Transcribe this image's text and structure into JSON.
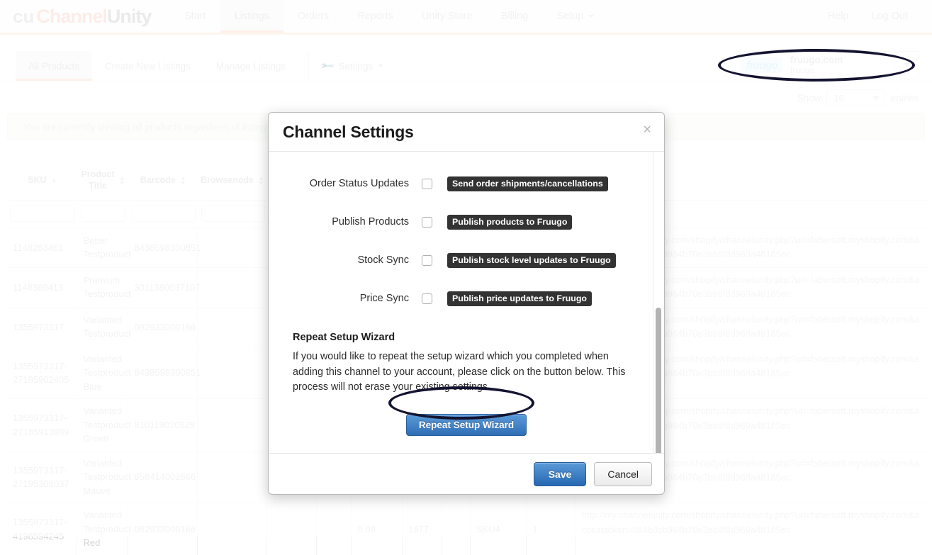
{
  "brand": {
    "mark": "cu",
    "name_1": "Channel",
    "name_2": "Unity"
  },
  "topnav": {
    "items": [
      {
        "label": "Start",
        "active": false
      },
      {
        "label": "Listings",
        "active": true
      },
      {
        "label": "Orders",
        "active": false
      },
      {
        "label": "Reports",
        "active": false
      },
      {
        "label": "Unity Store",
        "active": false
      },
      {
        "label": "Billing",
        "active": false
      },
      {
        "label": "Setup",
        "active": false,
        "caret": true
      }
    ],
    "right": [
      {
        "label": "Help"
      },
      {
        "label": "Log Out"
      }
    ]
  },
  "subtabs": [
    {
      "label": "All Products",
      "active": true
    },
    {
      "label": "Create New Listings",
      "active": false
    },
    {
      "label": "Manage Listings",
      "active": false
    },
    {
      "label": "Settings",
      "active": false,
      "icon": "wrench-icon",
      "caret": true
    }
  ],
  "channel_selector": {
    "logo_text": "fruugo",
    "name": "fruugo.com",
    "sub": "fruugo"
  },
  "show_entries": {
    "prefix": "Show",
    "value": "10",
    "suffix": "entries"
  },
  "alert": {
    "text": "You are currently viewing all products regardless of listing status."
  },
  "table": {
    "columns": [
      {
        "key": "sku",
        "label": "SKU",
        "sort": "asc"
      },
      {
        "key": "title",
        "label": "Product Title",
        "sort": "both"
      },
      {
        "key": "barcode",
        "label": "Barcode",
        "sort": "both"
      },
      {
        "key": "browsenode",
        "label": "Browsenode",
        "sort": "both"
      }
    ],
    "filter_placeholder": "",
    "rows": [
      {
        "sku": "1148283461",
        "title": "Better Testproduct",
        "barcode": "8438598300851",
        "url": "http://my.channelunity.com/shopify/channelunity.php?url=fabersoft.myshopify.com&accesstoken=084b8cb964b70e3bb9f8d969a48185ec"
      },
      {
        "sku": "1148369413",
        "title": "Premium Testproduct",
        "barcode": "3011360037107",
        "url": "http://my.channelunity.com/shopify/channelunity.php?url=fabersoft.myshopify.com&accesstoken=084b8cb964b70e3bb9f8d969a48185ec"
      },
      {
        "sku": "1355973317",
        "title": "Varianted Testproduct",
        "barcode": "082933000166",
        "url": "http://my.channelunity.com/shopify/channelunity.php?url=fabersoft.myshopify.com&accesstoken=084b8cb964b70e3bb9f8d969a48185ec"
      },
      {
        "sku": "1355973317-27185902405",
        "title": "Varianted Testproduct Blue",
        "barcode": "8438598300851",
        "url": "http://my.channelunity.com/shopify/channelunity.php?url=fabersoft.myshopify.com&accesstoken=084b8cb964b70e3bb9f8d969a48185ec"
      },
      {
        "sku": "1355973317-27185913989",
        "title": "Varianted Testproduct Green",
        "barcode": "810119020529",
        "url": "http://my.channelunity.com/shopify/channelunity.php?url=fabersoft.myshopify.com&accesstoken=084b8cb964b70e3bb9f8d969a48185ec"
      },
      {
        "sku": "1355973317-27195308037",
        "title": "Varianted Testproduct Mauve",
        "barcode": "858414002666",
        "url": "http://my.channelunity.com/shopify/channelunity.php?url=fabersoft.myshopify.com&accesstoken=084b8cb964b70e3bb9f8d969a48185ec"
      },
      {
        "sku": "1355973317-4198594245",
        "title": "Varianted Testproduct Red",
        "barcode": "082933000166",
        "price": "0.99",
        "qty": "1977",
        "code": "SKU4",
        "flag": "1",
        "url": "http://my.channelunity.com/shopify/channelunity.php?url=fabersoft.myshopify.com&accesstoken=084b8cb964b70e3bb9f8d969a48185ec"
      }
    ]
  },
  "modal": {
    "title": "Channel Settings",
    "close_label": "×",
    "rows": [
      {
        "label": "Order Status Updates",
        "tip": "Send order shipments/cancellations",
        "checked": false
      },
      {
        "label": "Publish Products",
        "tip": "Publish products to Fruugo",
        "checked": false
      },
      {
        "label": "Stock Sync",
        "tip": "Publish stock level updates to Fruugo",
        "checked": false
      },
      {
        "label": "Price Sync",
        "tip": "Publish price updates to Fruugo",
        "checked": false
      }
    ],
    "wizard": {
      "heading": "Repeat Setup Wizard",
      "body": "If you would like to repeat the setup wizard which you completed when adding this channel to your account, please click on the button below. This process will not erase your existing settings.",
      "button": "Repeat Setup Wizard"
    },
    "footer": {
      "save": "Save",
      "cancel": "Cancel"
    }
  },
  "colors": {
    "accent_orange": "#f8cdb2",
    "annotation": "#141431",
    "primary_blue": "#2f6eb5",
    "tooltip_bg": "#333333"
  }
}
